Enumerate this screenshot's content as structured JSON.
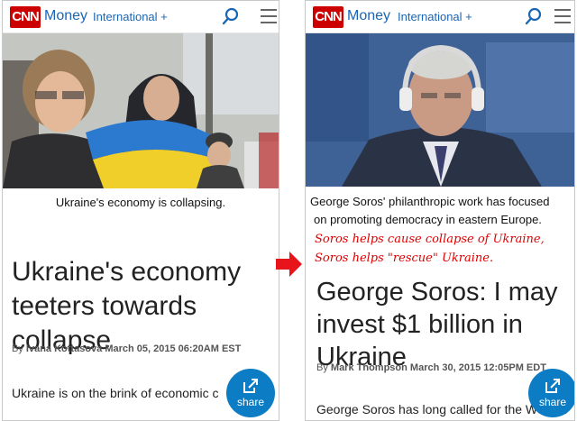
{
  "left": {
    "header": {
      "logo": "CNN",
      "section": "Money",
      "edition": "International +"
    },
    "photo_caption": "Ukraine's economy is collapsing.",
    "headline": "Ukraine's economy teeters towards collapse",
    "byline_prefix": "By",
    "byline": "Ivana Kottasova March 05, 2015 06:20AM EST",
    "body": "Ukraine is on the brink of economic c",
    "share_label": "share",
    "icons": [
      "search-icon",
      "menu-icon",
      "share-icon"
    ]
  },
  "right": {
    "header": {
      "logo": "CNN",
      "section": "Money",
      "edition": "International +"
    },
    "photo_caption_line1": "George Soros' philanthropic work has focused",
    "photo_caption_line2": "on promoting democracy in eastern Europe.",
    "annotation_line1": "Soros helps cause collapse of Ukraine,",
    "annotation_line2": "Soros helps \"rescue\" Ukraine.",
    "headline": "George Soros: I may invest $1 billion in Ukraine",
    "byline_prefix": "By",
    "byline": "Mark Thompson March 30, 2015 12:05PM EDT",
    "body": "George Soros has long called for the West to",
    "share_label": "share",
    "icons": [
      "search-icon",
      "menu-icon",
      "share-icon"
    ]
  },
  "colors": {
    "cnn_red": "#cc0000",
    "link_blue": "#1a66b3",
    "share_blue": "#0c7cc4",
    "annotation_red": "#e00000",
    "arrow_red": "#e8141c"
  }
}
